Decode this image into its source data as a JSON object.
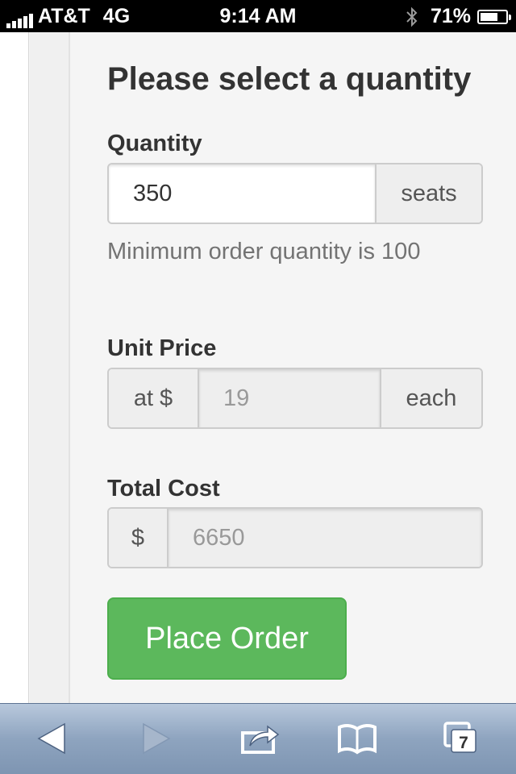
{
  "status_bar": {
    "carrier": "AT&T",
    "network": "4G",
    "time": "9:14 AM",
    "battery_percent": "71%",
    "battery_level": 0.71,
    "icons": [
      "signal-bars-icon",
      "bluetooth-icon",
      "battery-icon"
    ]
  },
  "form": {
    "heading": "Please select a quantity",
    "quantity": {
      "label": "Quantity",
      "value": "350",
      "suffix": "seats",
      "help": "Minimum order quantity is 100"
    },
    "unit_price": {
      "label": "Unit Price",
      "prefix": "at $",
      "value": "19",
      "suffix": "each"
    },
    "total_cost": {
      "label": "Total Cost",
      "prefix": "$",
      "value": "6650"
    },
    "submit_label": "Place Order"
  },
  "toolbar": {
    "tabs_count": "7",
    "icons": [
      "back-arrow-icon",
      "forward-arrow-icon",
      "share-icon",
      "bookmarks-icon",
      "tabs-icon"
    ]
  },
  "colors": {
    "button_green": "#5cb85c",
    "status_bar_bg": "#000000",
    "toolbar_blue": "#8ea4bf"
  }
}
